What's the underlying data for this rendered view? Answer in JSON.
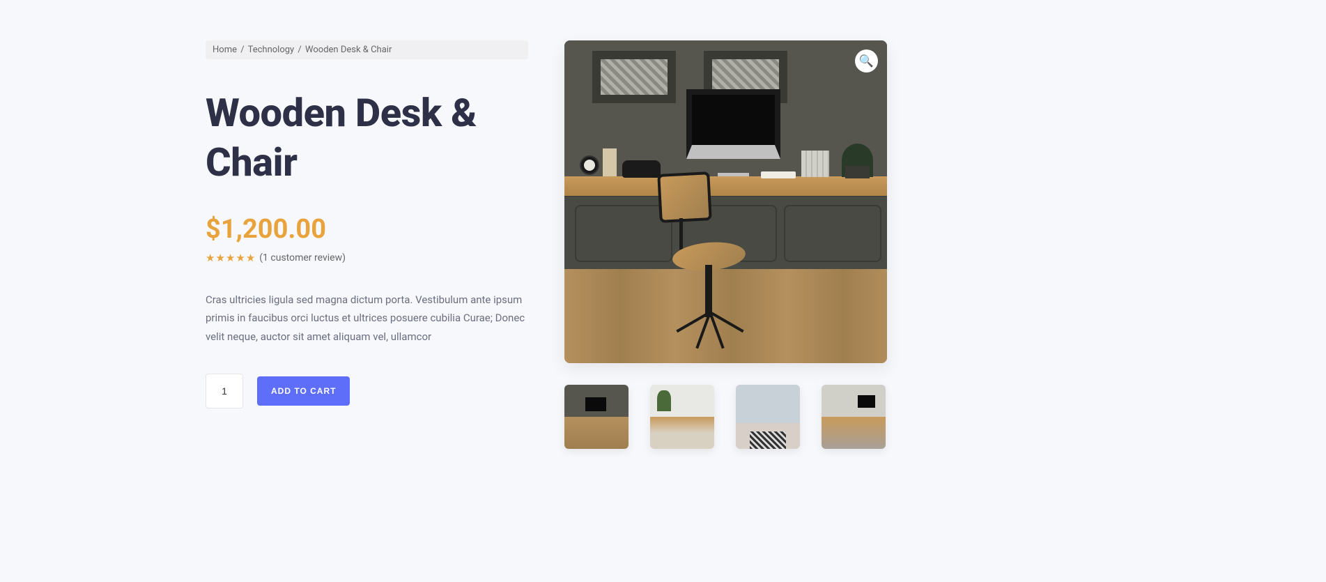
{
  "breadcrumb": {
    "items": [
      {
        "label": "Home",
        "link": true
      },
      {
        "label": "Technology",
        "link": true
      },
      {
        "label": "Wooden Desk & Chair",
        "link": false
      }
    ]
  },
  "product": {
    "title": "Wooden Desk & Chair",
    "currency": "$",
    "price": "1,200.00",
    "rating": 5,
    "review_text": "(1 customer review)",
    "description": "Cras ultricies ligula sed magna dictum porta. Vestibulum ante ipsum primis in faucibus orci luctus et ultrices posuere cubilia Curae; Donec velit neque, auctor sit amet aliquam vel, ullamcor",
    "quantity": "1",
    "add_to_cart_label": "ADD TO CART"
  },
  "gallery": {
    "zoom_icon": "🔍",
    "thumbnails": [
      {
        "id": "thumb-1"
      },
      {
        "id": "thumb-2"
      },
      {
        "id": "thumb-3"
      },
      {
        "id": "thumb-4"
      }
    ]
  }
}
